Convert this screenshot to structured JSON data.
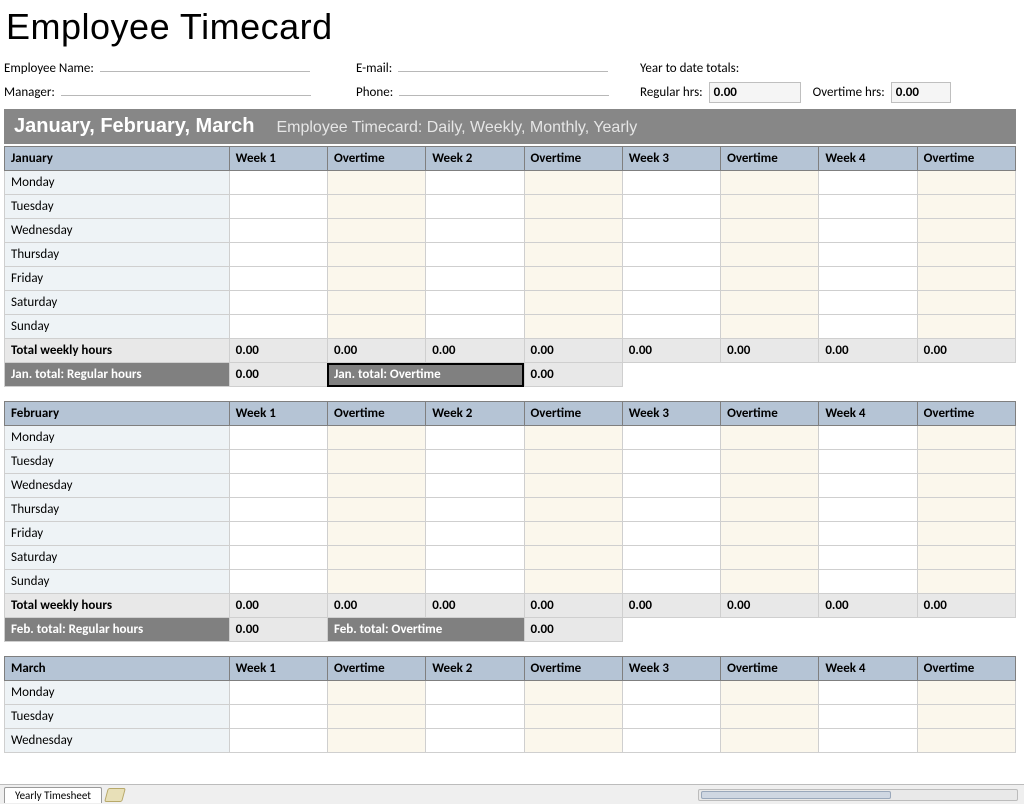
{
  "title": "Employee Timecard",
  "info": {
    "employee_name_label": "Employee Name:",
    "manager_label": "Manager:",
    "email_label": "E-mail:",
    "phone_label": "Phone:",
    "ytd_label": "Year to date totals:",
    "regular_label": "Regular hrs:",
    "regular_value": "0.00",
    "overtime_label": "Overtime hrs:",
    "overtime_value": "0.00"
  },
  "quarter": {
    "title": "January, February, March",
    "subtitle": "Employee Timecard: Daily, Weekly, Monthly, Yearly"
  },
  "columns": {
    "w1": "Week 1",
    "o1": "Overtime",
    "w2": "Week 2",
    "o2": "Overtime",
    "w3": "Week 3",
    "o3": "Overtime",
    "w4": "Week 4",
    "o4": "Overtime"
  },
  "days": [
    "Monday",
    "Tuesday",
    "Wednesday",
    "Thursday",
    "Friday",
    "Saturday",
    "Sunday"
  ],
  "total_row_label": "Total weekly hours",
  "months": {
    "jan": {
      "name": "January",
      "weekly_totals": [
        "0.00",
        "0.00",
        "0.00",
        "0.00",
        "0.00",
        "0.00",
        "0.00",
        "0.00"
      ],
      "month_reg_label": "Jan. total: Regular hours",
      "month_reg_value": "0.00",
      "month_ot_label": "Jan. total: Overtime",
      "month_ot_value": "0.00"
    },
    "feb": {
      "name": "February",
      "weekly_totals": [
        "0.00",
        "0.00",
        "0.00",
        "0.00",
        "0.00",
        "0.00",
        "0.00",
        "0.00"
      ],
      "month_reg_label": "Feb. total: Regular hours",
      "month_reg_value": "0.00",
      "month_ot_label": "Feb.  total: Overtime",
      "month_ot_value": "0.00"
    },
    "mar": {
      "name": "March"
    }
  },
  "tab_name": "Yearly Timesheet"
}
